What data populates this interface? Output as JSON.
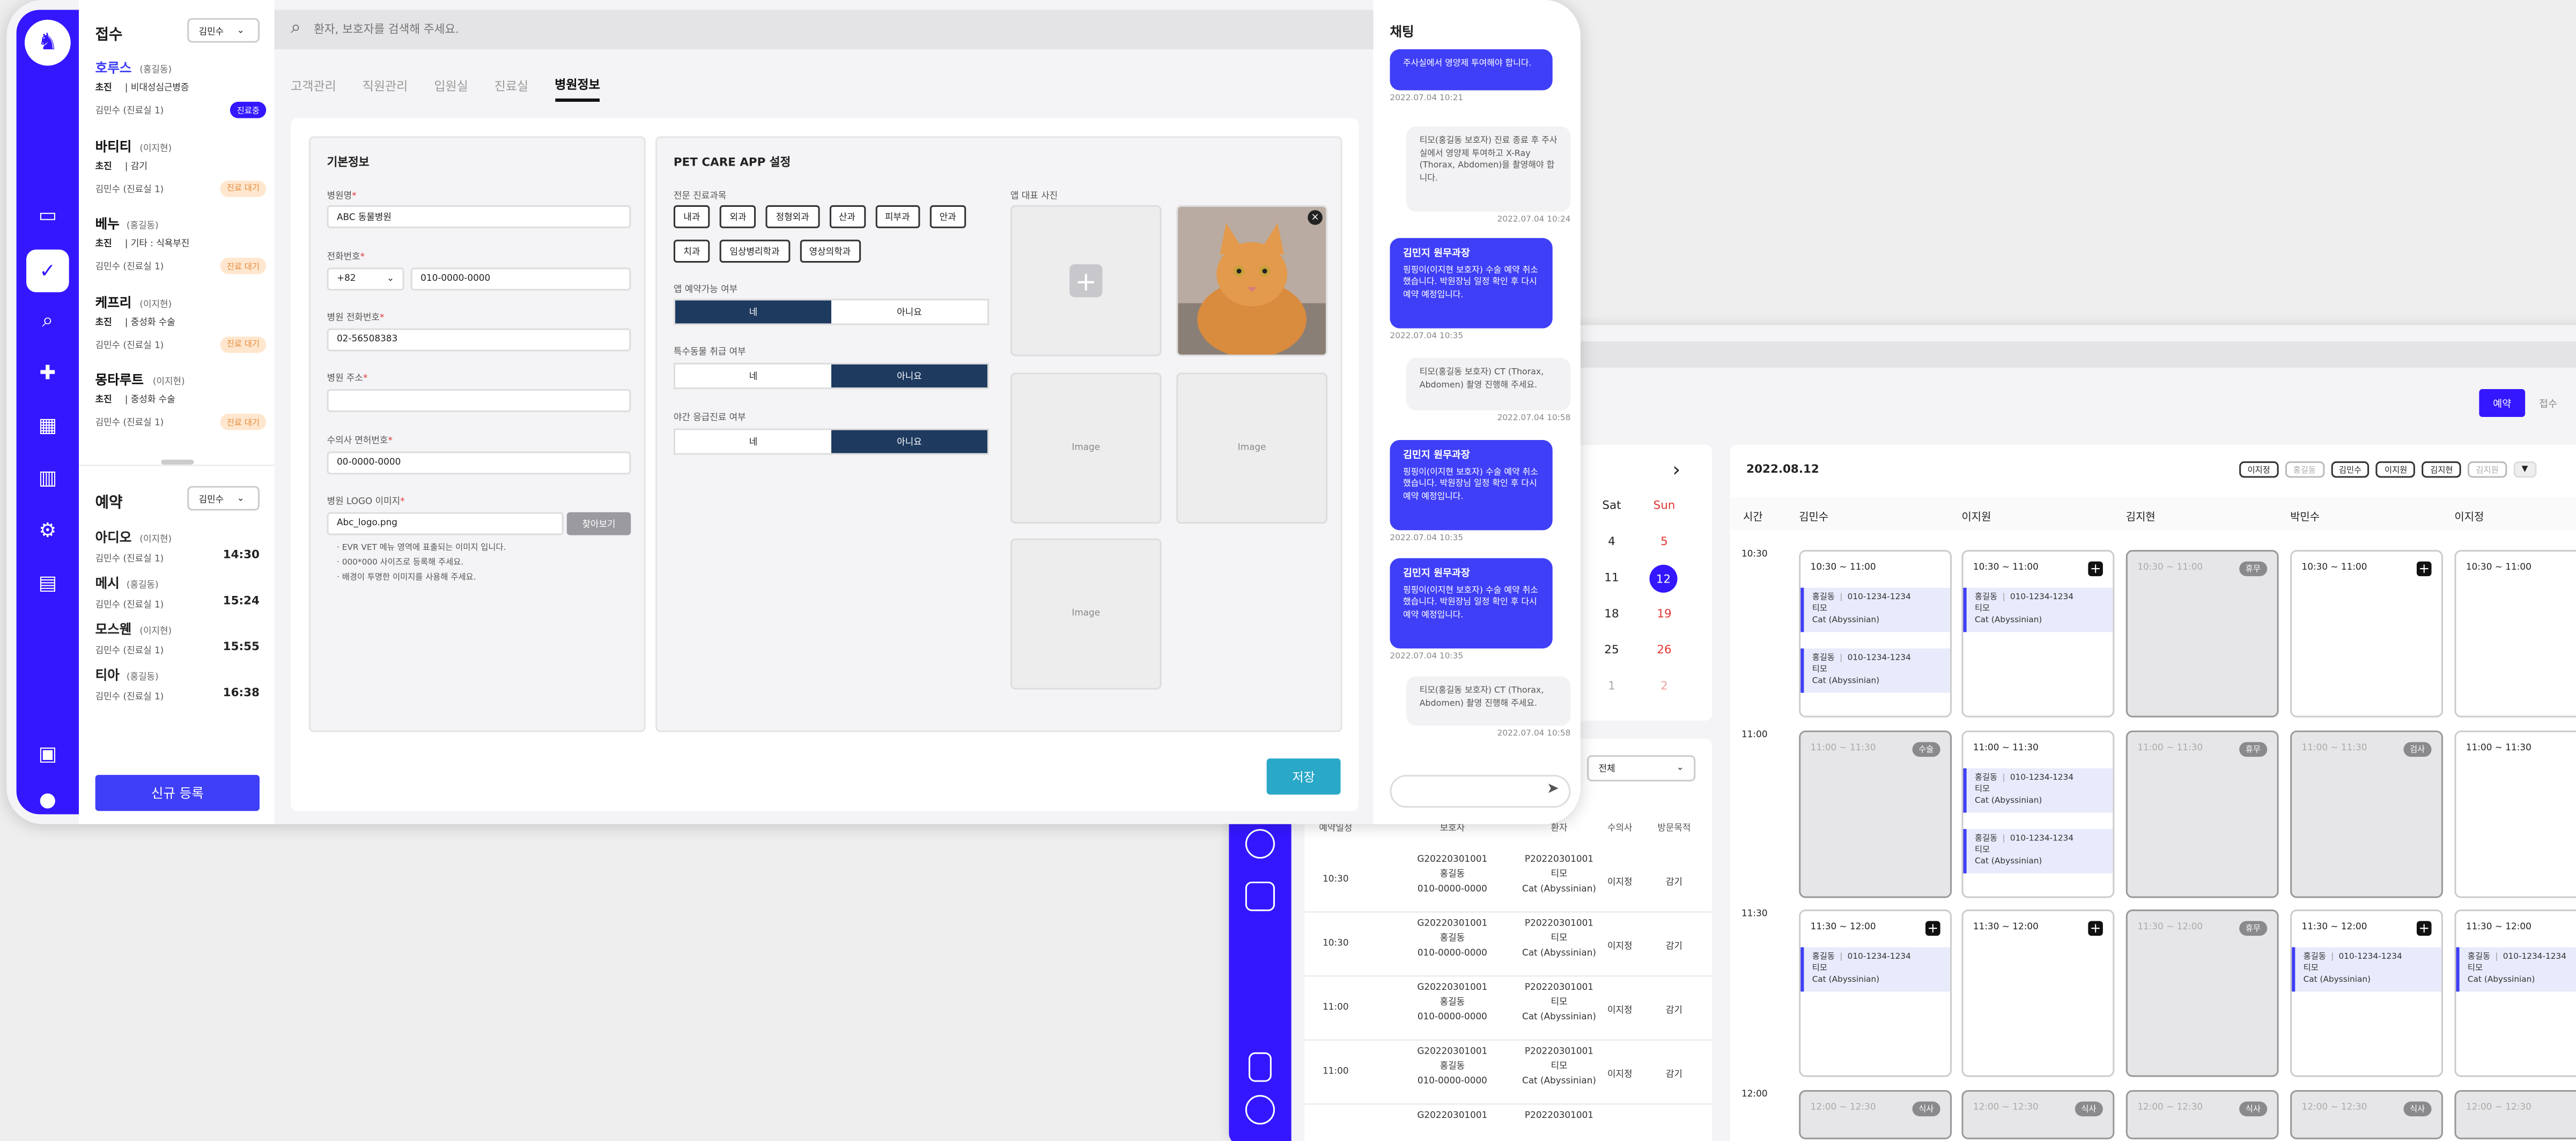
{
  "reception": {
    "title": "접수",
    "staff_select": "김민수",
    "items": [
      {
        "name": "호루스",
        "owner": "(홍길동)",
        "type": "초진",
        "diag": "비대성심근병증",
        "room": "김민수 (진료실 1)",
        "status": "진료중",
        "active": true
      },
      {
        "name": "바티티",
        "owner": "(이지현)",
        "type": "초진",
        "diag": "감기",
        "room": "김민수 (진료실 1)",
        "status": "진료 대기"
      },
      {
        "name": "베누",
        "owner": "(홍길동)",
        "type": "초진",
        "diag": "기타 : 식욕부진",
        "room": "김민수 (진료실 1)",
        "status": "진료 대기"
      },
      {
        "name": "케프리",
        "owner": "(이지현)",
        "type": "초진",
        "diag": "중성화 수술",
        "room": "김민수 (진료실 1)",
        "status": "진료 대기"
      },
      {
        "name": "몽타루트",
        "owner": "(이지현)",
        "type": "초진",
        "diag": "중성화 수술",
        "room": "김민수 (진료실 1)",
        "status": "진료 대기"
      }
    ]
  },
  "reservation": {
    "title": "예약",
    "staff_select": "김민수",
    "items": [
      {
        "name": "아디오",
        "owner": "(이지현)",
        "room": "김민수 (진료실 1)",
        "time": "14:30"
      },
      {
        "name": "메시",
        "owner": "(홍길동)",
        "room": "김민수 (진료실 1)",
        "time": "15:24"
      },
      {
        "name": "모스웬",
        "owner": "(이지현)",
        "room": "김민수 (진료실 1)",
        "time": "15:55"
      },
      {
        "name": "티아",
        "owner": "(홍길동)",
        "room": "김민수 (진료실 1)",
        "time": "16:38"
      }
    ]
  },
  "new_button": "신규 등록",
  "search": {
    "placeholder": "환자, 보호자를 검색해 주세요."
  },
  "tabs": [
    "고객관리",
    "직원관리",
    "입원실",
    "진료실",
    "병원정보"
  ],
  "basic": {
    "title": "기본정보",
    "hospital_name_label": "병원명",
    "hospital_name": "ABC 동물병원",
    "phone_label": "전화번호",
    "country_code": "+82",
    "phone": "010-0000-0000",
    "hospital_phone_label": "병원 전화번호",
    "hospital_phone": "02-56508383",
    "address_label": "병원 주소",
    "address": "",
    "license_label": "수의사 면허번호",
    "license": "00-0000-0000",
    "logo_label": "병원 LOGO 이미지",
    "logo_file": "Abc_logo.png",
    "browse": "찾아보기",
    "notes": [
      "· EVR VET 메뉴 영역에 표출되는 이미지 입니다.",
      "· 000*000 사이즈로 등록해 주세요.",
      "· 배경이 투명한 이미지를 사용해 주세요."
    ]
  },
  "petcare": {
    "title": "PET CARE APP 설정",
    "specialty_label": "전문 진료과목",
    "specialties": [
      "내과",
      "외과",
      "정형외과",
      "산과",
      "피부과",
      "안과",
      "치과",
      "임상병리학과",
      "영상의학과"
    ],
    "booking_label": "앱 예약가능 여부",
    "exotic_label": "특수동물 취급 여부",
    "night_label": "야간 응급진료 여부",
    "yes": "네",
    "no": "아니요",
    "photo_label": "앱 대표 사진",
    "image_text": "Image"
  },
  "save": "저장",
  "chat": {
    "title": "채팅",
    "messages": [
      {
        "dir": "in",
        "text": "주사실에서 영양제 투여해야 합니다.",
        "time": "2022.07.04  10:21"
      },
      {
        "dir": "out",
        "text": "티모(홍길동 보호자) 진료 종료 후 주사실에서 영양제 투여하고 X-Ray (Thorax, Abdomen)을 촬영해야 합니다.",
        "time": "2022.07.04  10:24"
      },
      {
        "dir": "in",
        "title": "김민지 원무과장",
        "text": "핑핑이(이지현 보호자) 수술 예약 취소했습니다. 박원장님 일정 확인 후 다시 예약 예정입니다.",
        "time": "2022.07.04  10:35"
      },
      {
        "dir": "out",
        "text": "티모(홍길동 보호자) CT (Thorax, Abdomen) 촬영 진행해 주세요.",
        "time": "2022.07.04  10:58"
      },
      {
        "dir": "in",
        "title": "김민지 원무과장",
        "text": "핑핑이(이지현 보호자) 수술 예약 취소했습니다. 박원장님 일정 확인 후 다시 예약 예정입니다.",
        "time": "2022.07.04  10:35"
      },
      {
        "dir": "in",
        "title": "김민지 원무과장",
        "text": "핑핑이(이지현 보호자) 수술 예약 취소했습니다. 박원장님 일정 확인 후 다시 예약 예정입니다.",
        "time": "2022.07.04  10:35"
      },
      {
        "dir": "out",
        "text": "티모(홍길동 보호자) CT (Thorax, Abdomen) 촬영 진행해 주세요.",
        "time": "2022.07.04  10:58"
      }
    ]
  },
  "schedule": {
    "toggle": [
      "예약",
      "접수"
    ],
    "date": "2022.08.12",
    "filters": [
      "이지정",
      "홍길동",
      "김민수",
      "이지원",
      "김지현",
      "김지원"
    ],
    "time_label": "시간",
    "staff": [
      "김민수",
      "이지원",
      "김지현",
      "박민수",
      "이지정"
    ],
    "times": [
      "10:30",
      "11:00",
      "11:30",
      "12:00"
    ],
    "appt": {
      "name": "홍길동",
      "phone": "010-1234-1234",
      "pet": "티모",
      "breed": "Cat (Abyssinian)"
    },
    "tags": {
      "off": "휴무",
      "surgery": "수술",
      "exam": "검사",
      "meal": "식사"
    },
    "slots": [
      "10:30 ~ 11:00",
      "11:00 ~ 11:30",
      "11:30 ~ 12:00",
      "12:00 ~ 12:30"
    ]
  },
  "calendar": {
    "sat": "Sat",
    "sun": "Sun",
    "rows": [
      [
        "4",
        "5"
      ],
      [
        "11",
        "12"
      ],
      [
        "18",
        "19"
      ],
      [
        "25",
        "26"
      ],
      [
        "1",
        "2"
      ]
    ]
  },
  "list": {
    "select": "전체",
    "headers": [
      "예약일정",
      "보호자",
      "환자",
      "수의사",
      "방문목적"
    ],
    "rows": [
      {
        "time": "10:30",
        "owner_id": "G20220301001",
        "owner": "홍길동",
        "phone": "010-0000-0000",
        "pet_id": "P20220301001",
        "pet": "티모",
        "breed": "Cat (Abyssinian)",
        "vet": "이지정",
        "purpose": "감기"
      },
      {
        "time": "10:30",
        "owner_id": "G20220301001",
        "owner": "홍길동",
        "phone": "010-0000-0000",
        "pet_id": "P20220301001",
        "pet": "티모",
        "breed": "Cat (Abyssinian)",
        "vet": "이지정",
        "purpose": "감기"
      },
      {
        "time": "11:00",
        "owner_id": "G20220301001",
        "owner": "홍길동",
        "phone": "010-0000-0000",
        "pet_id": "P20220301001",
        "pet": "티모",
        "breed": "Cat (Abyssinian)",
        "vet": "이지정",
        "purpose": "감기"
      },
      {
        "time": "11:00",
        "owner_id": "G20220301001",
        "owner": "홍길동",
        "phone": "010-0000-0000",
        "pet_id": "P20220301001",
        "pet": "티모",
        "breed": "Cat (Abyssinian)",
        "vet": "이지정",
        "purpose": "감기"
      },
      {
        "time": "",
        "owner_id": "G20220301001",
        "owner": "",
        "phone": "",
        "pet_id": "P20220301001",
        "pet": "",
        "breed": "",
        "vet": "",
        "purpose": ""
      }
    ]
  },
  "colors": {
    "brand": "#3417ff",
    "accent": "#3f3ff7",
    "save": "#2aa8c8",
    "navy": "#1e3a5f"
  }
}
